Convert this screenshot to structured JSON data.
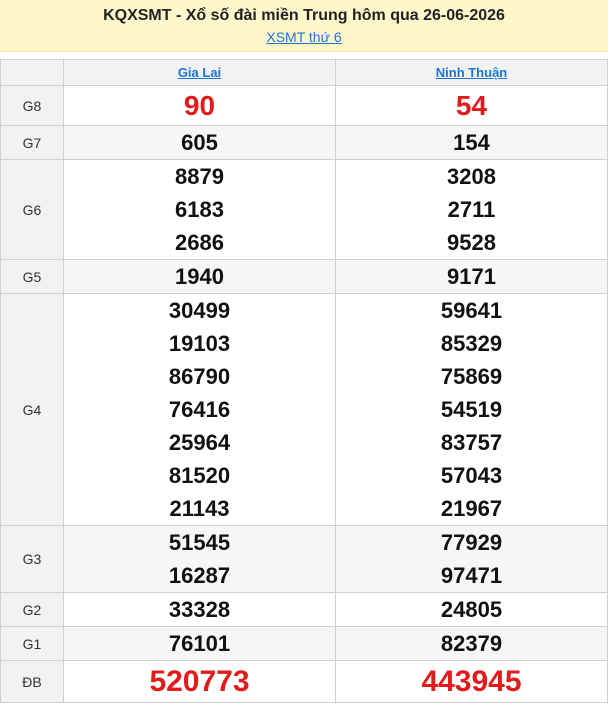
{
  "header": {
    "title": "KQXSMT - Xổ số đài miền Trung hôm qua 26-06-2026",
    "link": "XSMT thứ 6"
  },
  "provinces": [
    "Gia Lai",
    "Ninh Thuận"
  ],
  "prizes": [
    {
      "label": "G8",
      "values": [
        [
          "90"
        ],
        [
          "54"
        ]
      ]
    },
    {
      "label": "G7",
      "values": [
        [
          "605"
        ],
        [
          "154"
        ]
      ]
    },
    {
      "label": "G6",
      "values": [
        [
          "8879",
          "6183",
          "2686"
        ],
        [
          "3208",
          "2711",
          "9528"
        ]
      ]
    },
    {
      "label": "G5",
      "values": [
        [
          "1940"
        ],
        [
          "9171"
        ]
      ]
    },
    {
      "label": "G4",
      "values": [
        [
          "30499",
          "19103",
          "86790",
          "76416",
          "25964",
          "81520",
          "21143"
        ],
        [
          "59641",
          "85329",
          "75869",
          "54519",
          "83757",
          "57043",
          "21967"
        ]
      ]
    },
    {
      "label": "G3",
      "values": [
        [
          "51545",
          "16287"
        ],
        [
          "77929",
          "97471"
        ]
      ]
    },
    {
      "label": "G2",
      "values": [
        [
          "33328"
        ],
        [
          "24805"
        ]
      ]
    },
    {
      "label": "G1",
      "values": [
        [
          "76101"
        ],
        [
          "82379"
        ]
      ]
    },
    {
      "label": "ĐB",
      "values": [
        [
          "520773"
        ],
        [
          "443945"
        ]
      ]
    }
  ],
  "colors": {
    "header_bg": "#fff7cc",
    "link": "#1b74d6",
    "special_prize": "#e21b1b",
    "label_bg": "#f2f2f2"
  }
}
